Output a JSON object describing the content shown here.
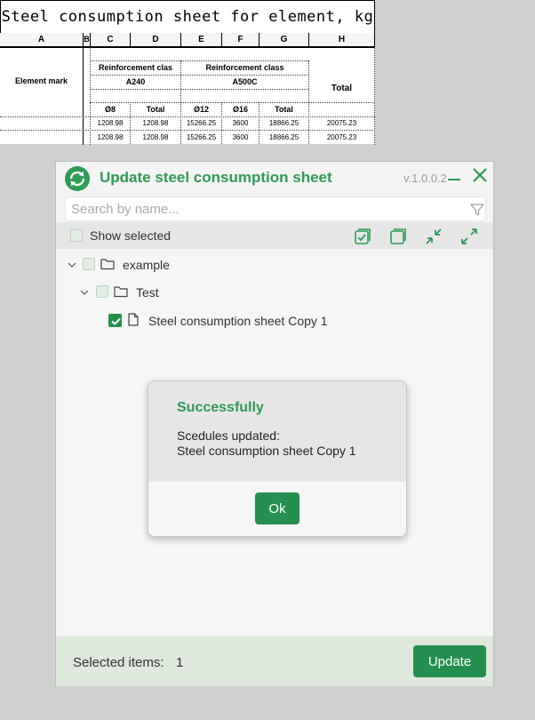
{
  "sheet": {
    "title": "Steel consumption sheet for element, kg",
    "columns": [
      "A",
      "B",
      "C",
      "D",
      "E",
      "F",
      "G",
      "H"
    ],
    "header": {
      "element_mark": "Element mark",
      "reinforcement_class_1": "Reinforcement clas",
      "reinforcement_class_2": "Reinforcement class",
      "class_a240": "A240",
      "class_a500c": "A500C",
      "total": "Total",
      "d8": "Ø8",
      "total_d": "Total",
      "d12": "Ø12",
      "d16": "Ø16",
      "total_g": "Total"
    },
    "rows": [
      [
        "1208.98",
        "1208.98",
        "15266.25",
        "3600",
        "18866.25",
        "20075.23"
      ],
      [
        "1208.98",
        "1208.98",
        "15266.25",
        "3600",
        "18866.25",
        "20075.23"
      ]
    ]
  },
  "window": {
    "title": "Update steel consumption sheet",
    "version": "v.1.0.0.2",
    "search_placeholder": "Search by name...",
    "show_selected_label": "Show selected",
    "tree": {
      "root_label": "example",
      "child_label": "Test",
      "leaf_label": "Steel consumption sheet Copy 1"
    },
    "footer": {
      "selected_label": "Selected items:",
      "selected_count": "1",
      "update_label": "Update"
    },
    "accent_color": "#2e9b57"
  },
  "modal": {
    "title": "Successfully",
    "line1": "Scedules updated:",
    "line2": "Steel consumption sheet Copy 1",
    "ok_label": "Ok"
  },
  "icons": [
    "app-logo-icon",
    "minimize-icon",
    "close-icon",
    "filter-icon",
    "select-all-icon",
    "copy-icon",
    "collapse-icon",
    "expand-icon",
    "chevron-down-icon",
    "folder-icon",
    "file-icon",
    "checkmark-icon"
  ]
}
